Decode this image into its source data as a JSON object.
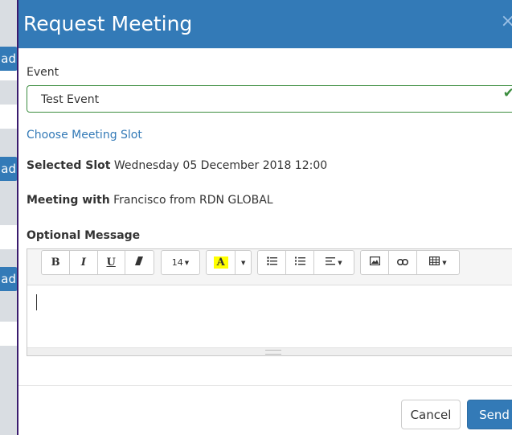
{
  "background": {
    "buttons": [
      {
        "label": "ad"
      },
      {
        "label": "ad"
      },
      {
        "label": "ad"
      }
    ]
  },
  "modal": {
    "title": "Request Meeting",
    "close_glyph": "×",
    "event": {
      "label": "Event",
      "selected": "Test Event"
    },
    "choose_slot_link": "Choose Meeting Slot",
    "selected_slot": {
      "label": "Selected Slot",
      "value": "Wednesday 05 December 2018 12:00"
    },
    "meeting_with": {
      "label": "Meeting with",
      "value": "Francisco from RDN GLOBAL"
    },
    "optional_message": {
      "label": "Optional Message"
    },
    "toolbar": {
      "bold": "B",
      "italic": "I",
      "underline": "U",
      "font_size": "14",
      "highlight": "A"
    },
    "footer": {
      "cancel": "Cancel",
      "send": "Send"
    }
  },
  "colors": {
    "primary": "#337ab7",
    "success_border": "#3c8d3f"
  }
}
